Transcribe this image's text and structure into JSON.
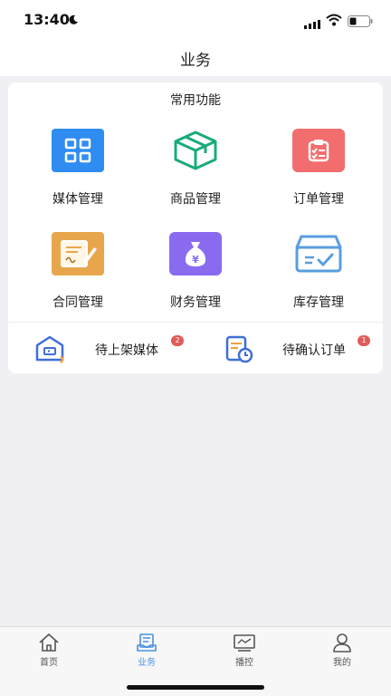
{
  "status_bar": {
    "time": "13:40"
  },
  "header": {
    "title": "业务"
  },
  "functions": {
    "title": "常用功能",
    "items": [
      {
        "label": "媒体管理",
        "icon": "grid-icon",
        "color": "#2f8df2"
      },
      {
        "label": "商品管理",
        "icon": "box-icon",
        "color": "#1aab7a"
      },
      {
        "label": "订单管理",
        "icon": "clipboard-icon",
        "color": "#f26d6d"
      },
      {
        "label": "合同管理",
        "icon": "contract-icon",
        "color": "#e8a64c"
      },
      {
        "label": "财务管理",
        "icon": "money-bag-icon",
        "color": "#8a6bf0"
      },
      {
        "label": "库存管理",
        "icon": "inventory-box-icon",
        "color": "#5a9de0"
      }
    ]
  },
  "todos": [
    {
      "label": "待上架媒体",
      "badge": "2",
      "icon": "shelf-icon"
    },
    {
      "label": "待确认订单",
      "badge": "1",
      "icon": "order-clock-icon"
    }
  ],
  "tab_bar": {
    "items": [
      {
        "label": "首页",
        "icon": "home-icon"
      },
      {
        "label": "业务",
        "icon": "business-icon",
        "active": true
      },
      {
        "label": "播控",
        "icon": "broadcast-icon"
      },
      {
        "label": "我的",
        "icon": "user-icon"
      }
    ]
  }
}
